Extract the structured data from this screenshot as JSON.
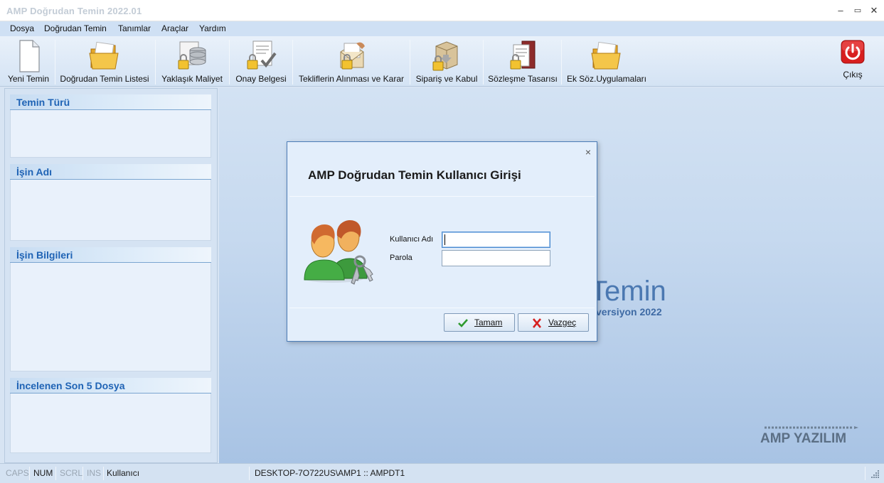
{
  "window": {
    "title": "AMP Doğrudan Temin  2022.01",
    "minimize": "–",
    "maximize": "▭",
    "close": "✕"
  },
  "menu": [
    "Dosya",
    "Doğrudan Temin",
    "Tanımlar",
    "Araçlar",
    "Yardım"
  ],
  "toolbar": {
    "items": [
      {
        "label": "Yeni Temin",
        "icon": "new-document-icon"
      },
      {
        "label": "Doğrudan Temin Listesi",
        "icon": "folder-icon"
      },
      {
        "label": "Yaklaşık Maliyet",
        "icon": "coins-icon"
      },
      {
        "label": "Onay Belgesi",
        "icon": "approved-document-icon"
      },
      {
        "label": "Tekliflerin Alınması ve Karar",
        "icon": "envelope-icon"
      },
      {
        "label": "Sipariş ve Kabul",
        "icon": "package-icon"
      },
      {
        "label": "Sözleşme Tasarısı",
        "icon": "contract-icon"
      },
      {
        "label": "Ek Söz.Uygulamaları",
        "icon": "folder-icon"
      }
    ],
    "exit_label": "Çıkış"
  },
  "left_panel": {
    "sections": [
      {
        "title": "Temin Türü"
      },
      {
        "title": "İşin Adı"
      },
      {
        "title": "İşin Bilgileri"
      },
      {
        "title": "İncelenen Son 5 Dosya"
      }
    ]
  },
  "background": {
    "title_fragment": "Temin",
    "version": "versiyon 2022",
    "logo_text": "AMP YAZILIM"
  },
  "dialog": {
    "title": "AMP Doğrudan Temin Kullanıcı Girişi",
    "close": "×",
    "username_label": "Kullanıcı Adı",
    "username_value": "",
    "password_label": "Parola",
    "password_value": "",
    "ok_label": "Tamam",
    "cancel_label": "Vazgeç",
    "ok_accent": "#2e9a2e",
    "cancel_accent": "#d62020"
  },
  "status": {
    "caps": "CAPS",
    "num": "NUM",
    "scrl": "SCRL",
    "ins": "INS",
    "user": "Kullanıcı",
    "connection": "DESKTOP-7O722US\\AMP1 :: AMPDT1"
  }
}
